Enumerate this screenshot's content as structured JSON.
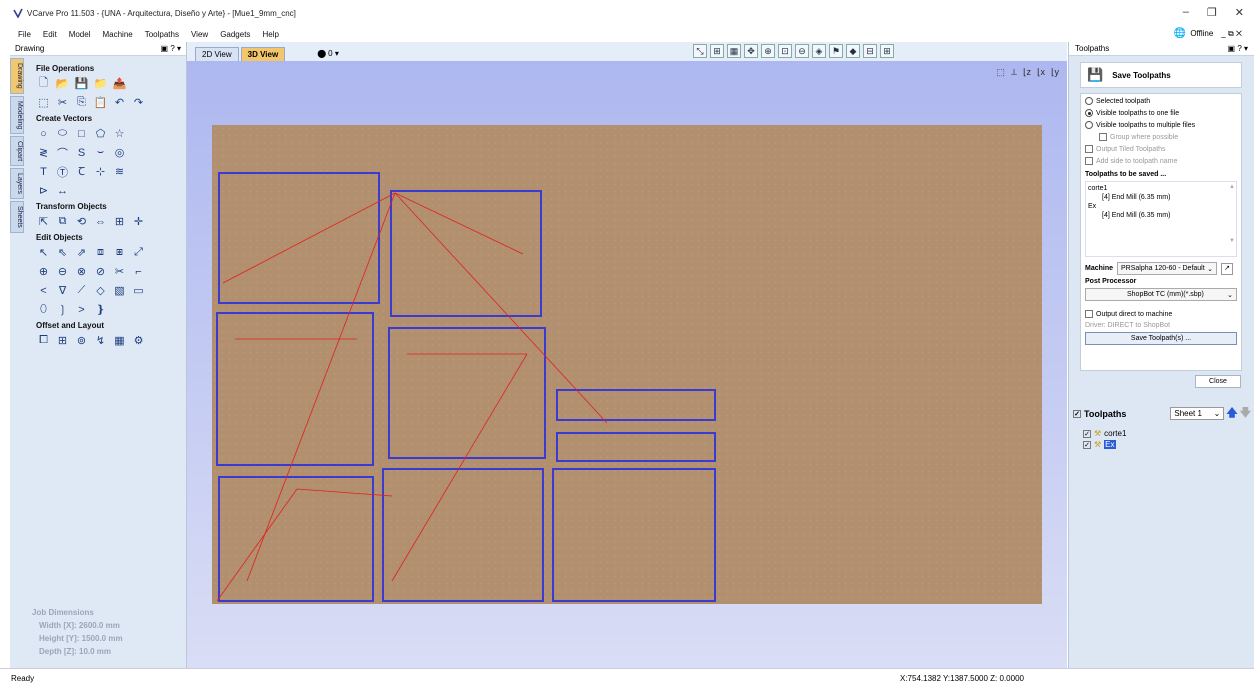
{
  "titlebar": {
    "title": "VCarve Pro 11.503 - {UNA - Arquitectura, Diseño y Arte} - [Mue1_9mm_cnc]",
    "min": "–",
    "max": "❐",
    "close": "✕"
  },
  "menu": [
    "File",
    "Edit",
    "Model",
    "Machine",
    "Toolpaths",
    "View",
    "Gadgets",
    "Help"
  ],
  "offline": {
    "label": "Offline",
    "extras": "_ ⧉ ✕"
  },
  "left_panel": {
    "header": "Drawing",
    "header_icons": "▣ ? ▾",
    "side_tabs": [
      "Drawing",
      "Modeling",
      "Clipart",
      "Layers",
      "Sheets"
    ],
    "sections": {
      "file_ops": "File Operations",
      "create_vectors": "Create Vectors",
      "transform": "Transform Objects",
      "edit": "Edit Objects",
      "offset": "Offset and Layout"
    },
    "job_dims": {
      "title": "Job Dimensions",
      "width": "Width  [X]: 2600.0 mm",
      "height": "Height [Y]: 1500.0 mm",
      "depth": "Depth  [Z]: 10.0 mm"
    }
  },
  "view": {
    "tab_2d": "2D View",
    "tab_3d": "3D View",
    "layer_indicator": "0 ▾"
  },
  "right_panel": {
    "header": "Toolpaths",
    "header_icons": "▣ ? ▾",
    "save_title": "Save Toolpaths",
    "opt_selected": "Selected toolpath",
    "opt_visible_one": "Visible toolpaths to one file",
    "opt_visible_multi": "Visible toolpaths to multiple files",
    "opt_group": "Group where possible",
    "opt_tiled": "Output Tiled Toolpaths",
    "opt_addside": "Add side to toolpath name",
    "to_save_title": "Toolpaths to be saved ...",
    "to_save_lines": [
      "corte1",
      "    [4] End Mill (6.35 mm)",
      "Ex",
      "    [4] End Mill (6.35 mm)"
    ],
    "machine_label": "Machine",
    "machine_value": "PRSalpha 120-60 - Default",
    "post_label": "Post Processor",
    "post_value": "ShopBot TC (mm)(*.sbp)",
    "output_direct": "Output direct to machine",
    "driver": "Driver: DIRECT to ShopBot",
    "save_btn": "Save Toolpath(s) ...",
    "close_btn": "Close",
    "tp_title": "Toolpaths",
    "sheet": "Sheet 1",
    "toolpaths": [
      "corte1",
      "Ex"
    ]
  },
  "status": {
    "left": "Ready",
    "coords": "X:754.1382 Y:1387.5000 Z: 0.0000"
  },
  "colors": {
    "panel": "#dfe8f5",
    "viewport_top": "#aeb8f0",
    "material": "#b28f6e",
    "accent_tab": "#f2c66a",
    "vector": "#3b3bd1",
    "toolpath_red": "#e02020"
  }
}
